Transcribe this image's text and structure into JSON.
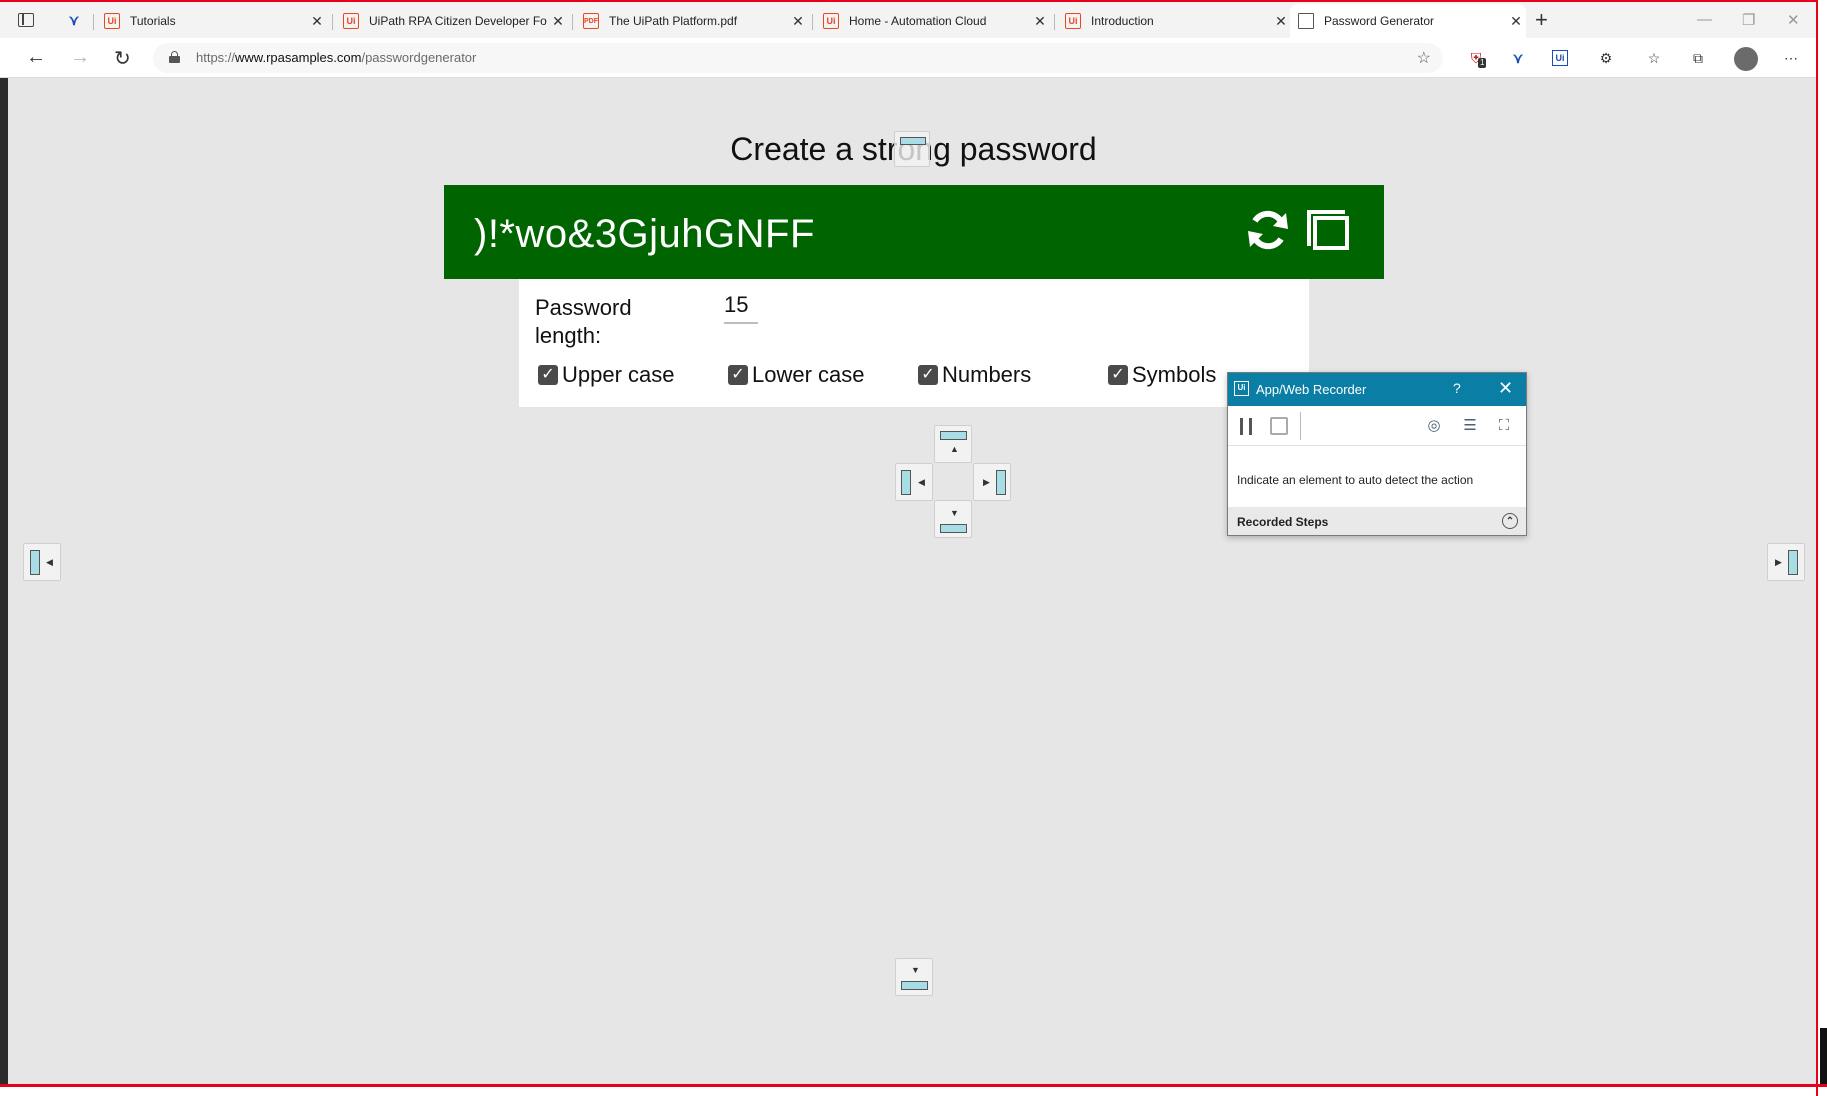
{
  "browser": {
    "tabs": [
      {
        "label": "Tutorials",
        "icon": "uipath-icon"
      },
      {
        "label": "UiPath RPA Citizen Developer Fo",
        "icon": "uipath-icon"
      },
      {
        "label": "The UiPath Platform.pdf",
        "icon": "pdf-icon"
      },
      {
        "label": "Home - Automation Cloud",
        "icon": "uipath-icon"
      },
      {
        "label": "Introduction",
        "icon": "uipath-icon"
      },
      {
        "label": "Password Generator",
        "icon": "page-icon",
        "active": true
      }
    ],
    "url_prefix": "https://",
    "url_host": "www.rpasamples.com",
    "url_path": "/passwordgenerator",
    "extension_badge": "1"
  },
  "page": {
    "title": "Create a strong password",
    "password": ")!*wo&3GjuhGNFF",
    "length_label": "Password length:",
    "length_value": "15",
    "options": [
      {
        "label": "Upper case",
        "checked": true
      },
      {
        "label": "Lower case",
        "checked": true
      },
      {
        "label": "Numbers",
        "checked": true
      },
      {
        "label": "Symbols",
        "checked": true
      }
    ],
    "accent_color": "#006400",
    "background_color": "#e6e6e6"
  },
  "recorder": {
    "title": "App/Web Recorder",
    "help": "?",
    "message": "Indicate an element to auto detect the action",
    "steps_label": "Recorded Steps",
    "title_color": "#0a7ea4"
  }
}
